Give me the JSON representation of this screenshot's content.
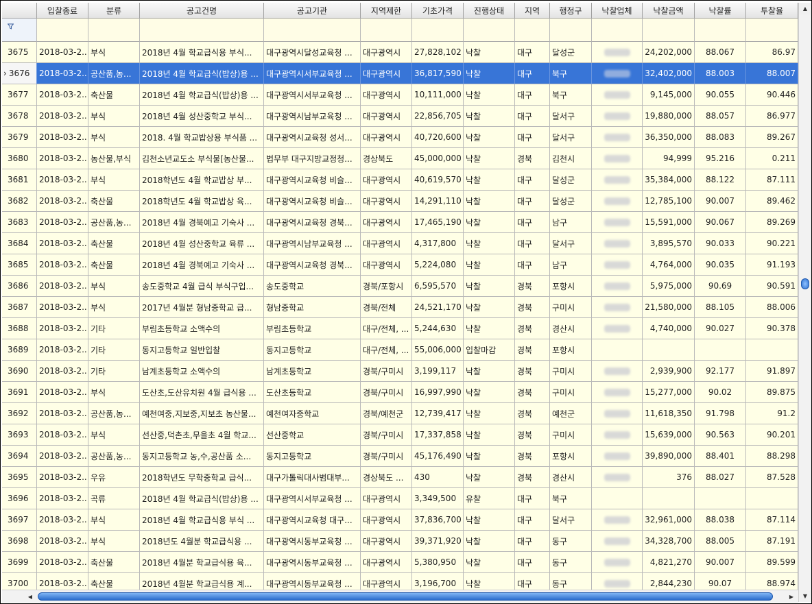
{
  "columns": [
    "",
    "입찰종료",
    "분류",
    "공고건명",
    "공고기관",
    "지역제한",
    "기초가격",
    "진행상태",
    "지역",
    "행정구",
    "낙찰업체",
    "낙찰금액",
    "낙찰률",
    "투찰율"
  ],
  "filter_icon": "filter-icon",
  "selected_marker": "›",
  "rows": [
    {
      "no": "3675",
      "date": "2018-03-2...",
      "cat": "부식",
      "title": "2018년 4월 학교급식용 부식...",
      "org": "대구광역시달성교육청 ...",
      "region": "대구광역시",
      "price": "27,828,102",
      "status": "낙찰",
      "area": "대구",
      "district": "달성군",
      "company": "blur",
      "amount": "24,202,000",
      "rate": "88.067",
      "bid": "86.97"
    },
    {
      "no": "3676",
      "date": "2018-03-2...",
      "cat": "공산품,농...",
      "title": "2018년 4월 학교급식(밥상)용 ...",
      "org": "대구광역시서부교육청 ...",
      "region": "대구광역시",
      "price": "36,817,590",
      "status": "낙찰",
      "area": "대구",
      "district": "북구",
      "company": "blur",
      "amount": "32,402,000",
      "rate": "88.003",
      "bid": "88.007",
      "selected": true
    },
    {
      "no": "3677",
      "date": "2018-03-2...",
      "cat": "축산물",
      "title": "2018년 4월 학교급식(밥상)용 ...",
      "org": "대구광역시서부교육청 ...",
      "region": "대구광역시",
      "price": "10,111,000",
      "status": "낙찰",
      "area": "대구",
      "district": "북구",
      "company": "blur",
      "amount": "9,145,000",
      "rate": "90.055",
      "bid": "90.446"
    },
    {
      "no": "3678",
      "date": "2018-03-2...",
      "cat": "부식",
      "title": "2018년 4월 성산중학교 부식...",
      "org": "대구광역시남부교육청 ...",
      "region": "대구광역시",
      "price": "22,856,705",
      "status": "낙찰",
      "area": "대구",
      "district": "달서구",
      "company": "blur",
      "amount": "19,880,000",
      "rate": "88.057",
      "bid": "86.977"
    },
    {
      "no": "3679",
      "date": "2018-03-2...",
      "cat": "부식",
      "title": "2018. 4월 학교밥상용 부식품 ...",
      "org": "대구광역시교육청 성서...",
      "region": "대구광역시",
      "price": "40,720,600",
      "status": "낙찰",
      "area": "대구",
      "district": "달서구",
      "company": "blur",
      "amount": "36,350,000",
      "rate": "88.083",
      "bid": "89.267"
    },
    {
      "no": "3680",
      "date": "2018-03-2...",
      "cat": "농산물,부식",
      "title": "김천소년교도소 부식물[농산물...",
      "org": "법무부 대구지방교정청...",
      "region": "경상북도",
      "price": "45,000,000",
      "status": "낙찰",
      "area": "경북",
      "district": "김천시",
      "company": "blur",
      "amount": "94,999",
      "rate": "95.216",
      "bid": "0.211"
    },
    {
      "no": "3681",
      "date": "2018-03-2...",
      "cat": "부식",
      "title": "2018학년도 4월 학교밥상 부...",
      "org": "대구광역시교육청 비슬...",
      "region": "대구광역시",
      "price": "40,619,570",
      "status": "낙찰",
      "area": "대구",
      "district": "달성군",
      "company": "blur",
      "amount": "35,384,000",
      "rate": "88.122",
      "bid": "87.111"
    },
    {
      "no": "3682",
      "date": "2018-03-2...",
      "cat": "축산물",
      "title": "2018학년도 4월 학교밥상 육...",
      "org": "대구광역시교육청 비슬...",
      "region": "대구광역시",
      "price": "14,291,110",
      "status": "낙찰",
      "area": "대구",
      "district": "달성군",
      "company": "blur",
      "amount": "12,785,100",
      "rate": "90.007",
      "bid": "89.462"
    },
    {
      "no": "3683",
      "date": "2018-03-2...",
      "cat": "공산품,농...",
      "title": "2018년 4월 경북예고 기숙사 ...",
      "org": "대구광역시교육청 경북...",
      "region": "대구광역시",
      "price": "17,465,190",
      "status": "낙찰",
      "area": "대구",
      "district": "남구",
      "company": "blur",
      "amount": "15,591,000",
      "rate": "90.067",
      "bid": "89.269"
    },
    {
      "no": "3684",
      "date": "2018-03-2...",
      "cat": "축산물",
      "title": "2018년 4월 성산중학교 육류 ...",
      "org": "대구광역시남부교육청 ...",
      "region": "대구광역시",
      "price": "4,317,800",
      "status": "낙찰",
      "area": "대구",
      "district": "달서구",
      "company": "blur",
      "amount": "3,895,570",
      "rate": "90.033",
      "bid": "90.221"
    },
    {
      "no": "3685",
      "date": "2018-03-2...",
      "cat": "축산물",
      "title": "2018년 4월 경북예고 기숙사 ...",
      "org": "대구광역시교육청 경북...",
      "region": "대구광역시",
      "price": "5,224,080",
      "status": "낙찰",
      "area": "대구",
      "district": "남구",
      "company": "blur",
      "amount": "4,764,000",
      "rate": "90.035",
      "bid": "91.193"
    },
    {
      "no": "3686",
      "date": "2018-03-2...",
      "cat": "부식",
      "title": "송도중학교 4월 급식 부식구입...",
      "org": "송도중학교",
      "region": "경북/포항시",
      "price": "6,595,570",
      "status": "낙찰",
      "area": "경북",
      "district": "포항시",
      "company": "blur",
      "amount": "5,975,000",
      "rate": "90.69",
      "bid": "90.591"
    },
    {
      "no": "3687",
      "date": "2018-03-2...",
      "cat": "부식",
      "title": "2017년 4월분 형남중학교 급...",
      "org": "형남중학교",
      "region": "경북/전체",
      "price": "24,521,170",
      "status": "낙찰",
      "area": "경북",
      "district": "구미시",
      "company": "blur",
      "amount": "21,580,000",
      "rate": "88.105",
      "bid": "88.006"
    },
    {
      "no": "3688",
      "date": "2018-03-2...",
      "cat": "기타",
      "title": "부림초등학교 소액수의",
      "org": "부림초등학교",
      "region": "대구/전체, ...",
      "price": "5,244,630",
      "status": "낙찰",
      "area": "경북",
      "district": "경산시",
      "company": "blur",
      "amount": "4,740,000",
      "rate": "90.027",
      "bid": "90.378"
    },
    {
      "no": "3689",
      "date": "2018-03-2...",
      "cat": "기타",
      "title": "동지고등학교 일반입찰",
      "org": "동지고등학교",
      "region": "대구/전체, ...",
      "price": "55,006,000",
      "status": "입찰마감",
      "area": "경북",
      "district": "포항시",
      "company": "",
      "amount": "",
      "rate": "",
      "bid": ""
    },
    {
      "no": "3690",
      "date": "2018-03-2...",
      "cat": "기타",
      "title": "남계초등학교 소액수의",
      "org": "남계초등학교",
      "region": "경북/구미시",
      "price": "3,199,117",
      "status": "낙찰",
      "area": "경북",
      "district": "구미시",
      "company": "blur",
      "amount": "2,939,900",
      "rate": "92.177",
      "bid": "91.897"
    },
    {
      "no": "3691",
      "date": "2018-03-2...",
      "cat": "부식",
      "title": "도산초,도산유치원 4월 급식용 ...",
      "org": "도산초등학교",
      "region": "경북/구미시",
      "price": "16,997,990",
      "status": "낙찰",
      "area": "경북",
      "district": "구미시",
      "company": "blur",
      "amount": "15,277,000",
      "rate": "90.02",
      "bid": "89.875"
    },
    {
      "no": "3692",
      "date": "2018-03-2...",
      "cat": "공산품,농...",
      "title": "예천여중,지보중,지보초 농산물...",
      "org": "예천여자중학교",
      "region": "경북/예천군",
      "price": "12,739,417",
      "status": "낙찰",
      "area": "경북",
      "district": "예천군",
      "company": "blur",
      "amount": "11,618,350",
      "rate": "91.798",
      "bid": "91.2"
    },
    {
      "no": "3693",
      "date": "2018-03-2...",
      "cat": "부식",
      "title": "선산중,덕촌초,무을초 4월 학교...",
      "org": "선산중학교",
      "region": "경북/구미시",
      "price": "17,337,858",
      "status": "낙찰",
      "area": "경북",
      "district": "구미시",
      "company": "blur",
      "amount": "15,639,000",
      "rate": "90.563",
      "bid": "90.201"
    },
    {
      "no": "3694",
      "date": "2018-03-2...",
      "cat": "공산품,농...",
      "title": "동지고등학교 농,수,공산품 소...",
      "org": "동지고등학교",
      "region": "경북/구미시",
      "price": "45,176,490",
      "status": "낙찰",
      "area": "경북",
      "district": "포항시",
      "company": "blur",
      "amount": "39,890,000",
      "rate": "88.401",
      "bid": "88.298"
    },
    {
      "no": "3695",
      "date": "2018-03-2...",
      "cat": "우유",
      "title": "2018학년도 무학중학교 급식...",
      "org": "대구가톨릭대사범대부...",
      "region": "경상북도 ...",
      "price": "430",
      "status": "낙찰",
      "area": "경북",
      "district": "경산시",
      "company": "blur",
      "amount": "376",
      "rate": "88.027",
      "bid": "87.528"
    },
    {
      "no": "3696",
      "date": "2018-03-2...",
      "cat": "곡류",
      "title": "2018년 4월 학교급식(밥상)용 ...",
      "org": "대구광역시서부교육청 ...",
      "region": "대구광역시",
      "price": "3,349,500",
      "status": "유찰",
      "area": "대구",
      "district": "북구",
      "company": "",
      "amount": "",
      "rate": "",
      "bid": ""
    },
    {
      "no": "3697",
      "date": "2018-03-2...",
      "cat": "부식",
      "title": "2018년 4월 학교급식용 부식 ...",
      "org": "대구광역시교육청 대구...",
      "region": "대구광역시",
      "price": "37,836,700",
      "status": "낙찰",
      "area": "대구",
      "district": "달서구",
      "company": "blur",
      "amount": "32,961,000",
      "rate": "88.038",
      "bid": "87.114"
    },
    {
      "no": "3698",
      "date": "2018-03-2...",
      "cat": "부식",
      "title": "2018년도 4월분 학교급식용 ...",
      "org": "대구광역시동부교육청 ...",
      "region": "대구광역시",
      "price": "39,371,920",
      "status": "낙찰",
      "area": "대구",
      "district": "동구",
      "company": "blur",
      "amount": "34,328,700",
      "rate": "88.005",
      "bid": "87.191"
    },
    {
      "no": "3699",
      "date": "2018-03-2...",
      "cat": "축산물",
      "title": "2018년 4월분 학교급식용 육...",
      "org": "대구광역시동부교육청 ...",
      "region": "대구광역시",
      "price": "5,380,950",
      "status": "낙찰",
      "area": "대구",
      "district": "동구",
      "company": "blur",
      "amount": "4,821,270",
      "rate": "90.007",
      "bid": "89.599"
    },
    {
      "no": "3700",
      "date": "2018-03-2...",
      "cat": "축산물",
      "title": "2018년 4월분 학교급식용 계...",
      "org": "대구광역시동부교육청 ...",
      "region": "대구광역시",
      "price": "3,196,700",
      "status": "낙찰",
      "area": "대구",
      "district": "동구",
      "company": "blur",
      "amount": "2,844,230",
      "rate": "90.07",
      "bid": "88.974"
    }
  ]
}
